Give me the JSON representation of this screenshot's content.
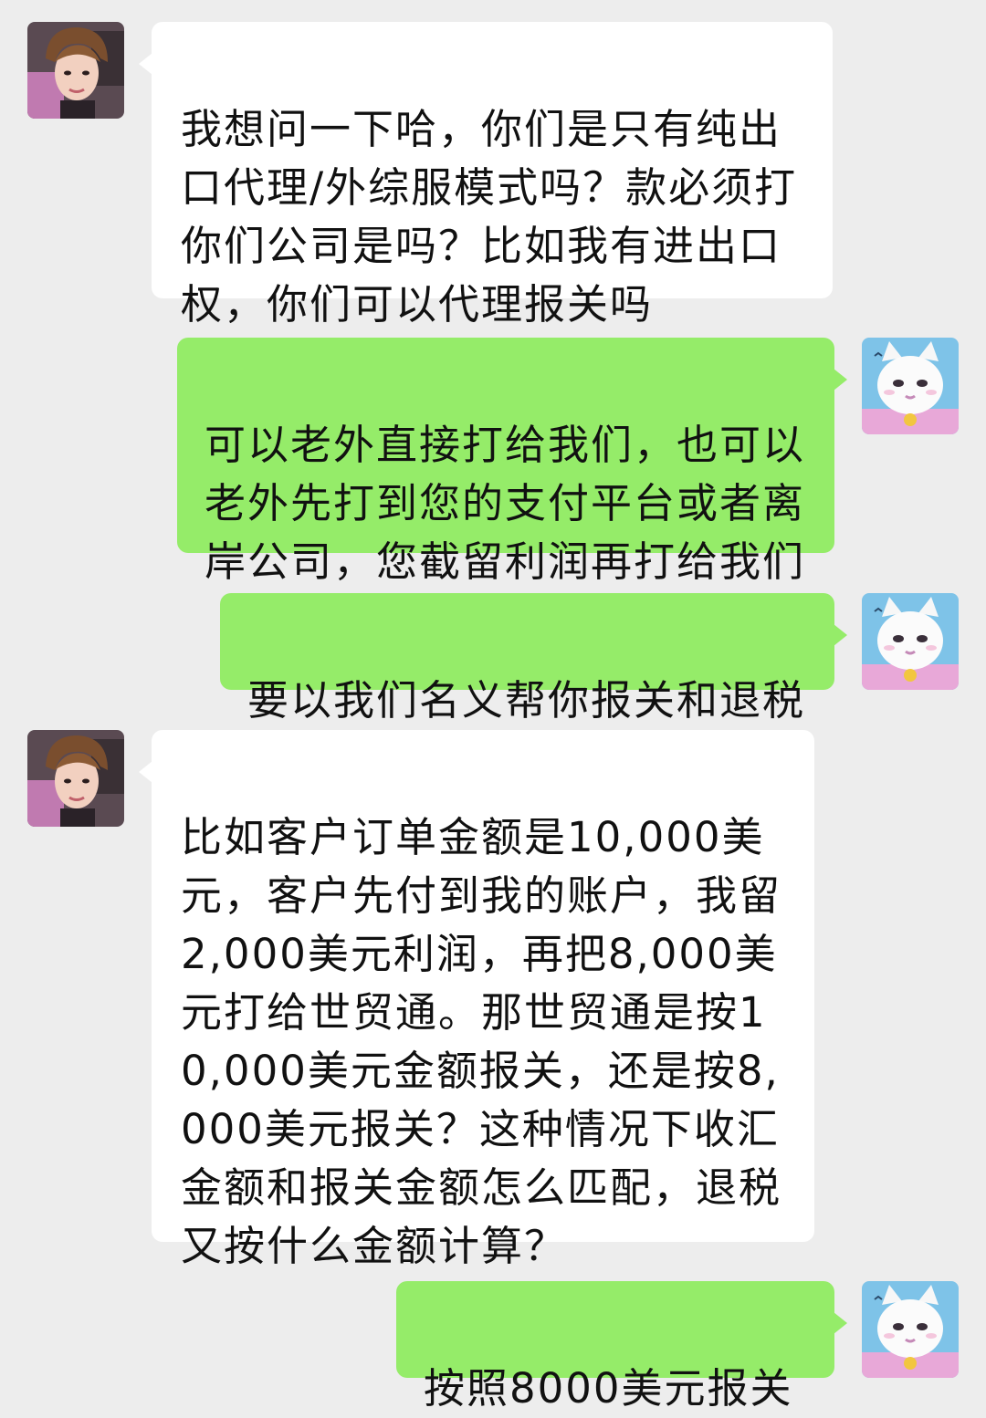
{
  "colors": {
    "background": "#ededed",
    "incoming_bubble": "#ffffff",
    "outgoing_bubble": "#95ec69",
    "text": "#111111"
  },
  "contacts": {
    "other_avatar_icon": "woman-portrait-avatar",
    "self_avatar_icon": "white-cat-cartoon-avatar"
  },
  "messages": [
    {
      "sender": "other",
      "text": "我想问一下哈，你们是只有纯出口代理/外综服模式吗？款必须打你们公司是吗？比如我有进出口权，你们可以代理报关吗"
    },
    {
      "sender": "self",
      "text": "可以老外直接打给我们，也可以老外先打到您的支付平台或者离岸公司，您截留利润再打给我们"
    },
    {
      "sender": "self",
      "text": "要以我们名义帮你报关和退税"
    },
    {
      "sender": "other",
      "text": "比如客户订单金额是10,000美元，客户先付到我的账户，我留2,000美元利润，再把8,000美元打给世贸通。那世贸通是按10,000美元金额报关，还是按8,000美元报关？这种情况下收汇金额和报关金额怎么匹配，退税又按什么金额计算？"
    },
    {
      "sender": "self",
      "text": "按照8000美元报关"
    }
  ]
}
